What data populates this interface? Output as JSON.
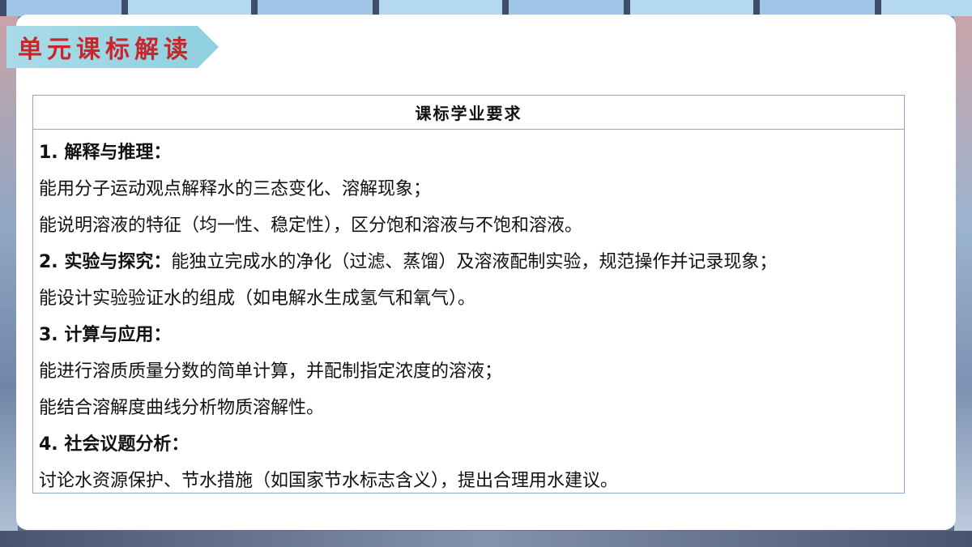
{
  "banner": {
    "title": "单元课标解读"
  },
  "table": {
    "header": "课标学业要求",
    "lines": [
      {
        "head": "1. 解释与推理：",
        "text": ""
      },
      {
        "head": "",
        "text": "能用分子运动观点解释水的三态变化、溶解现象；"
      },
      {
        "head": "",
        "text": "能说明溶液的特征（均一性、稳定性），区分饱和溶液与不饱和溶液。"
      },
      {
        "head": "2. 实验与探究：",
        "text": "能独立完成水的净化（过滤、蒸馏）及溶液配制实验，规范操作并记录现象；"
      },
      {
        "head": "",
        "text": "能设计实验验证水的组成（如电解水生成氢气和氧气）。"
      },
      {
        "head": "3. 计算与应用：",
        "text": ""
      },
      {
        "head": "",
        "text": "能进行溶质质量分数的简单计算，并配制指定浓度的溶液；"
      },
      {
        "head": "",
        "text": "能结合溶解度曲线分析物质溶解性。"
      },
      {
        "head": "4. 社会议题分析：",
        "text": ""
      },
      {
        "head": "",
        "text": "讨论水资源保护、节水措施（如国家节水标志含义），提出合理用水建议。"
      }
    ]
  }
}
